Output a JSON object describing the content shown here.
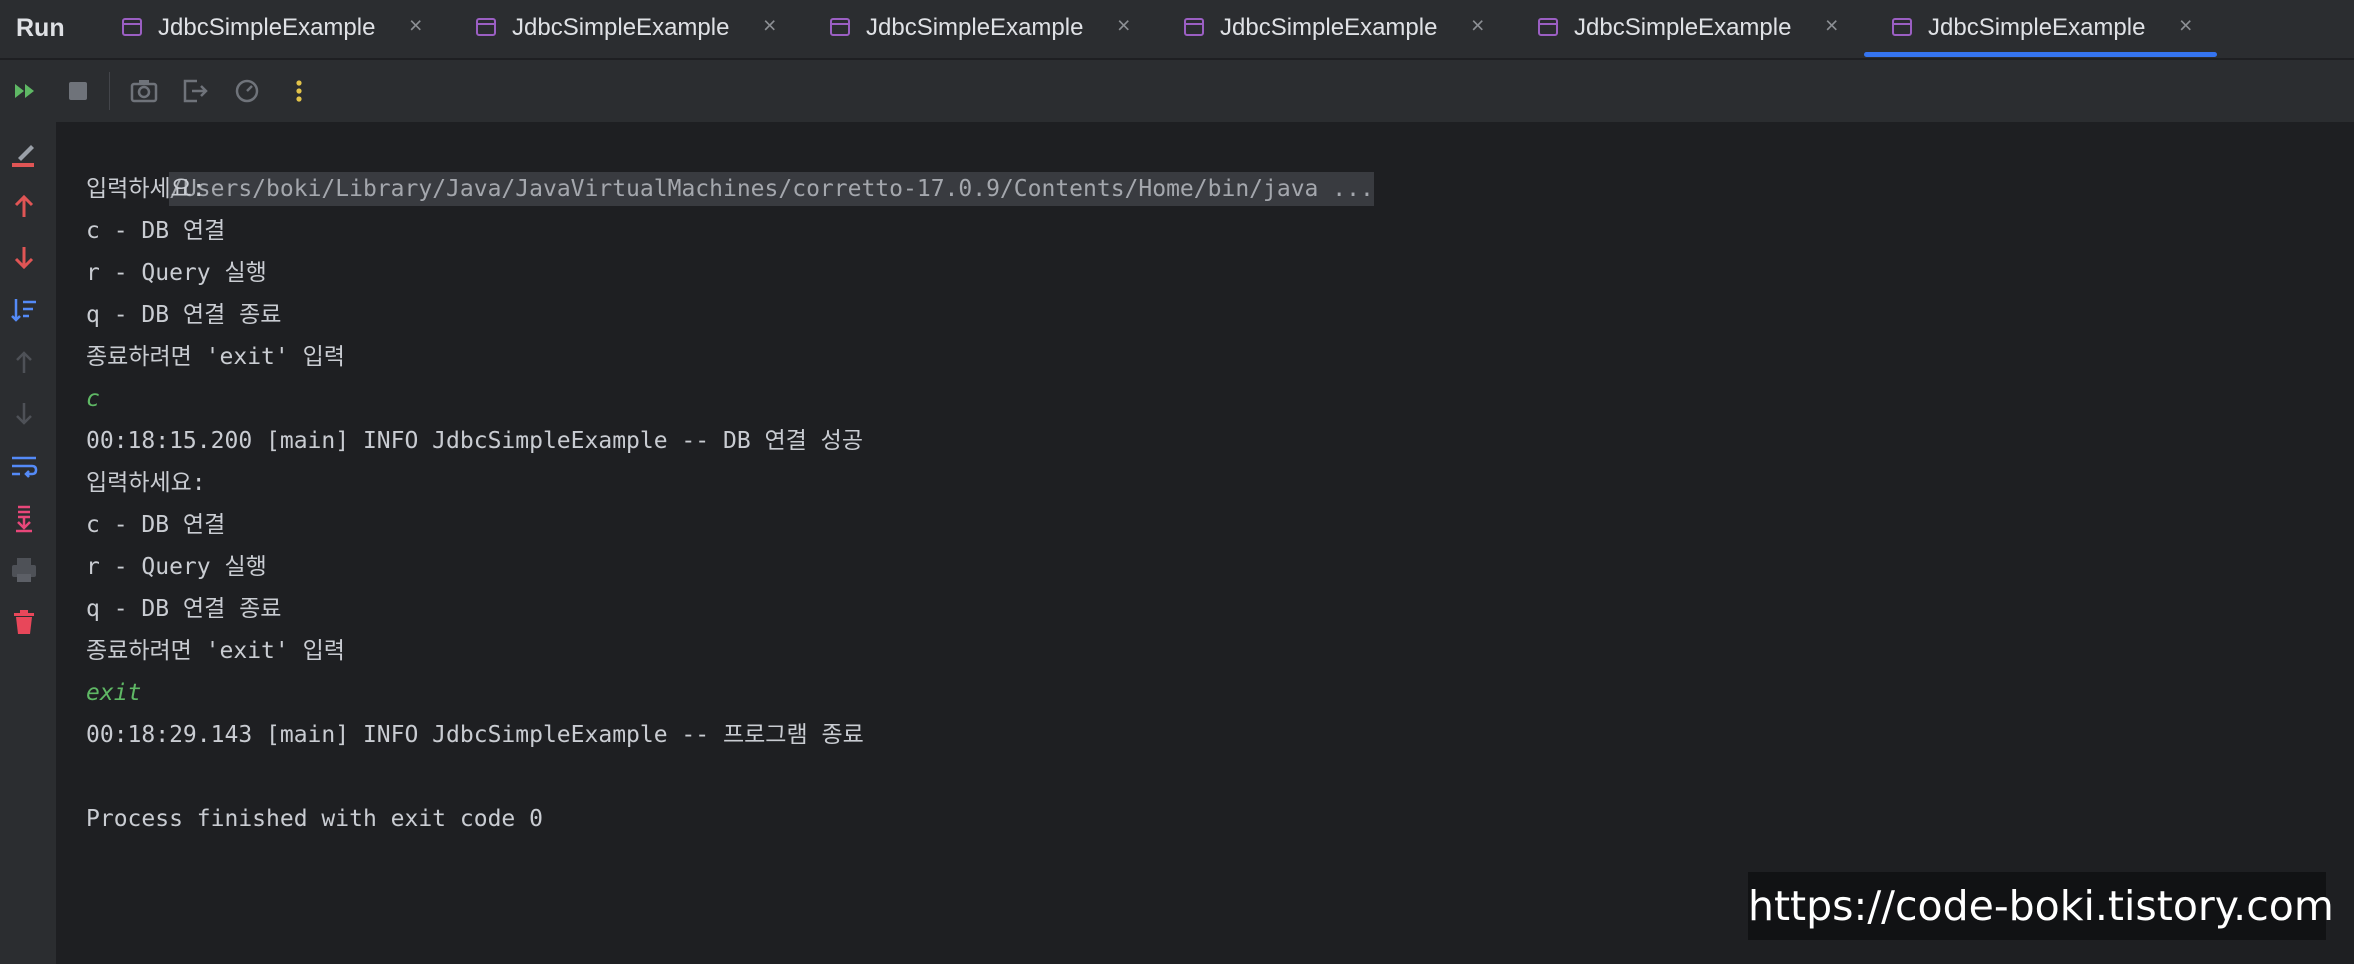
{
  "window": {
    "run_label": "Run"
  },
  "tabs": [
    {
      "label": "JdbcSimpleExample",
      "close": "×",
      "active": false
    },
    {
      "label": "JdbcSimpleExample",
      "close": "×",
      "active": false
    },
    {
      "label": "JdbcSimpleExample",
      "close": "×",
      "active": false
    },
    {
      "label": "JdbcSimpleExample",
      "close": "×",
      "active": false
    },
    {
      "label": "JdbcSimpleExample",
      "close": "×",
      "active": false
    },
    {
      "label": "JdbcSimpleExample",
      "close": "×",
      "active": true
    }
  ],
  "toolbar": {
    "icons": [
      "rerun-icon",
      "stop-icon",
      "camera-icon",
      "exit-icon",
      "dashboard-icon",
      "more-options-icon"
    ]
  },
  "gutter": {
    "icons": [
      "clear-edit-icon",
      "up-arrow-icon",
      "down-arrow-icon",
      "sort-icon",
      "up-arrow-disabled-icon",
      "down-arrow-disabled-icon",
      "soft-wrap-icon",
      "scroll-to-end-icon",
      "print-icon",
      "trash-icon"
    ]
  },
  "console": {
    "command_path": "/Users/boki/Library/Java/JavaVirtualMachines/corretto-17.0.9/Contents/Home/bin/java ...",
    "lines": [
      {
        "text": "입력하세요:",
        "kind": "out"
      },
      {
        "text": "c - DB 연결",
        "kind": "out"
      },
      {
        "text": "r - Query 실행",
        "kind": "out"
      },
      {
        "text": "q - DB 연결 종료",
        "kind": "out"
      },
      {
        "text": "종료하려면 'exit' 입력",
        "kind": "out"
      },
      {
        "text": "c",
        "kind": "cmd"
      },
      {
        "text": "00:18:15.200 [main] INFO JdbcSimpleExample -- DB 연결 성공",
        "kind": "out"
      },
      {
        "text": "입력하세요:",
        "kind": "out"
      },
      {
        "text": "c - DB 연결",
        "kind": "out"
      },
      {
        "text": "r - Query 실행",
        "kind": "out"
      },
      {
        "text": "q - DB 연결 종료",
        "kind": "out"
      },
      {
        "text": "종료하려면 'exit' 입력",
        "kind": "out"
      },
      {
        "text": "exit",
        "kind": "cmd"
      },
      {
        "text": "00:18:29.143 [main] INFO JdbcSimpleExample -- 프로그램 종료",
        "kind": "out"
      },
      {
        "text": "",
        "kind": "out"
      },
      {
        "text": "Process finished with exit code 0",
        "kind": "out"
      }
    ]
  },
  "watermark": {
    "text": "https://code-boki.tistory.com"
  },
  "colors": {
    "background": "#1e1f22",
    "panel": "#2b2d30",
    "text": "#c9ccd2",
    "user_input": "#5fb865",
    "tab_active_underline": "#3574f0",
    "tab_icon": "#9b5fc3",
    "rerun_green": "#5fb865",
    "error_red": "#e05555",
    "soft_wrap_blue": "#548af7",
    "scroll_end_pink": "#e8477a",
    "trash_red": "#e8475a"
  }
}
